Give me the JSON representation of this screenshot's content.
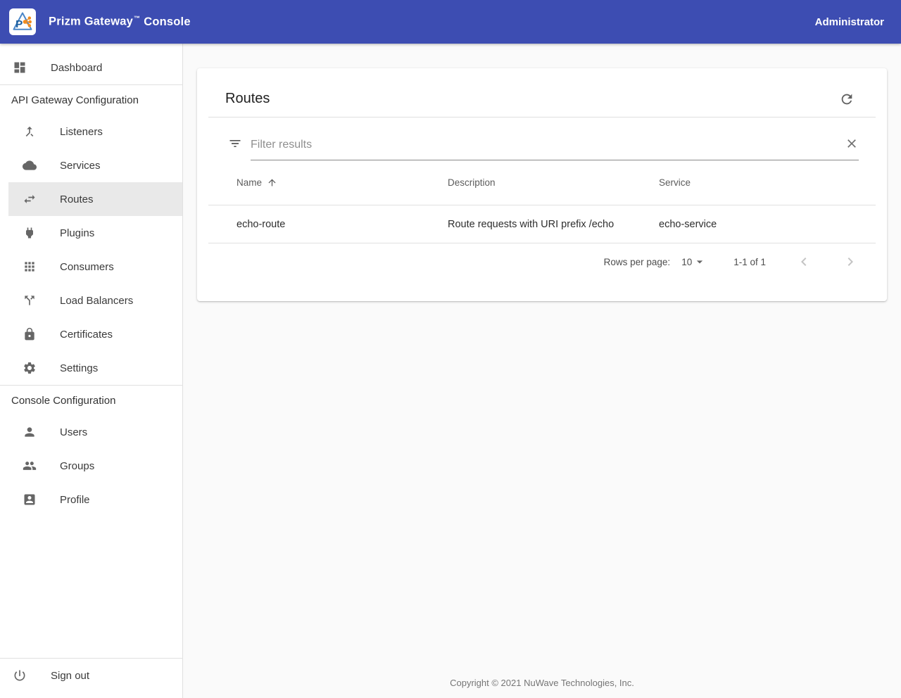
{
  "colors": {
    "header_bg": "#3d4db2",
    "logo_blue": "#1b5e9e",
    "logo_orange": "#f28c1e",
    "selected_item_bg": "#e9e9e9"
  },
  "header": {
    "title_main": "Prizm Gateway",
    "trademark": "™",
    "title_suffix": "Console",
    "user": "Administrator"
  },
  "sidebar": {
    "dashboard": {
      "label": "Dashboard",
      "icon": "dashboard-icon"
    },
    "sections": [
      {
        "label": "API Gateway Configuration",
        "items": [
          {
            "label": "Listeners",
            "icon": "call-merge-icon"
          },
          {
            "label": "Services",
            "icon": "cloud-icon"
          },
          {
            "label": "Routes",
            "icon": "swap-horizontal-icon",
            "selected": true
          },
          {
            "label": "Plugins",
            "icon": "power-plug-icon"
          },
          {
            "label": "Consumers",
            "icon": "apps-grid-icon"
          },
          {
            "label": "Load Balancers",
            "icon": "call-split-icon"
          },
          {
            "label": "Certificates",
            "icon": "lock-icon"
          },
          {
            "label": "Settings",
            "icon": "gear-icon"
          }
        ]
      },
      {
        "label": "Console Configuration",
        "items": [
          {
            "label": "Users",
            "icon": "person-icon"
          },
          {
            "label": "Groups",
            "icon": "people-icon"
          },
          {
            "label": "Profile",
            "icon": "contact-card-icon"
          }
        ]
      }
    ],
    "signout": {
      "label": "Sign out",
      "icon": "power-icon"
    }
  },
  "main": {
    "card": {
      "title": "Routes",
      "filter": {
        "placeholder": "Filter results"
      },
      "table": {
        "columns": [
          {
            "label": "Name",
            "sort": "ascending"
          },
          {
            "label": "Description",
            "sort": null
          },
          {
            "label": "Service",
            "sort": null
          }
        ],
        "rows": [
          {
            "name": "echo-route",
            "description": "Route requests with URI prefix /echo",
            "service": "echo-service"
          }
        ]
      },
      "pagination": {
        "rows_per_page_label": "Rows per page:",
        "rows_per_page_value": "10",
        "range": "1-1 of 1"
      }
    },
    "footer": "Copyright © 2021 NuWave Technologies, Inc."
  }
}
